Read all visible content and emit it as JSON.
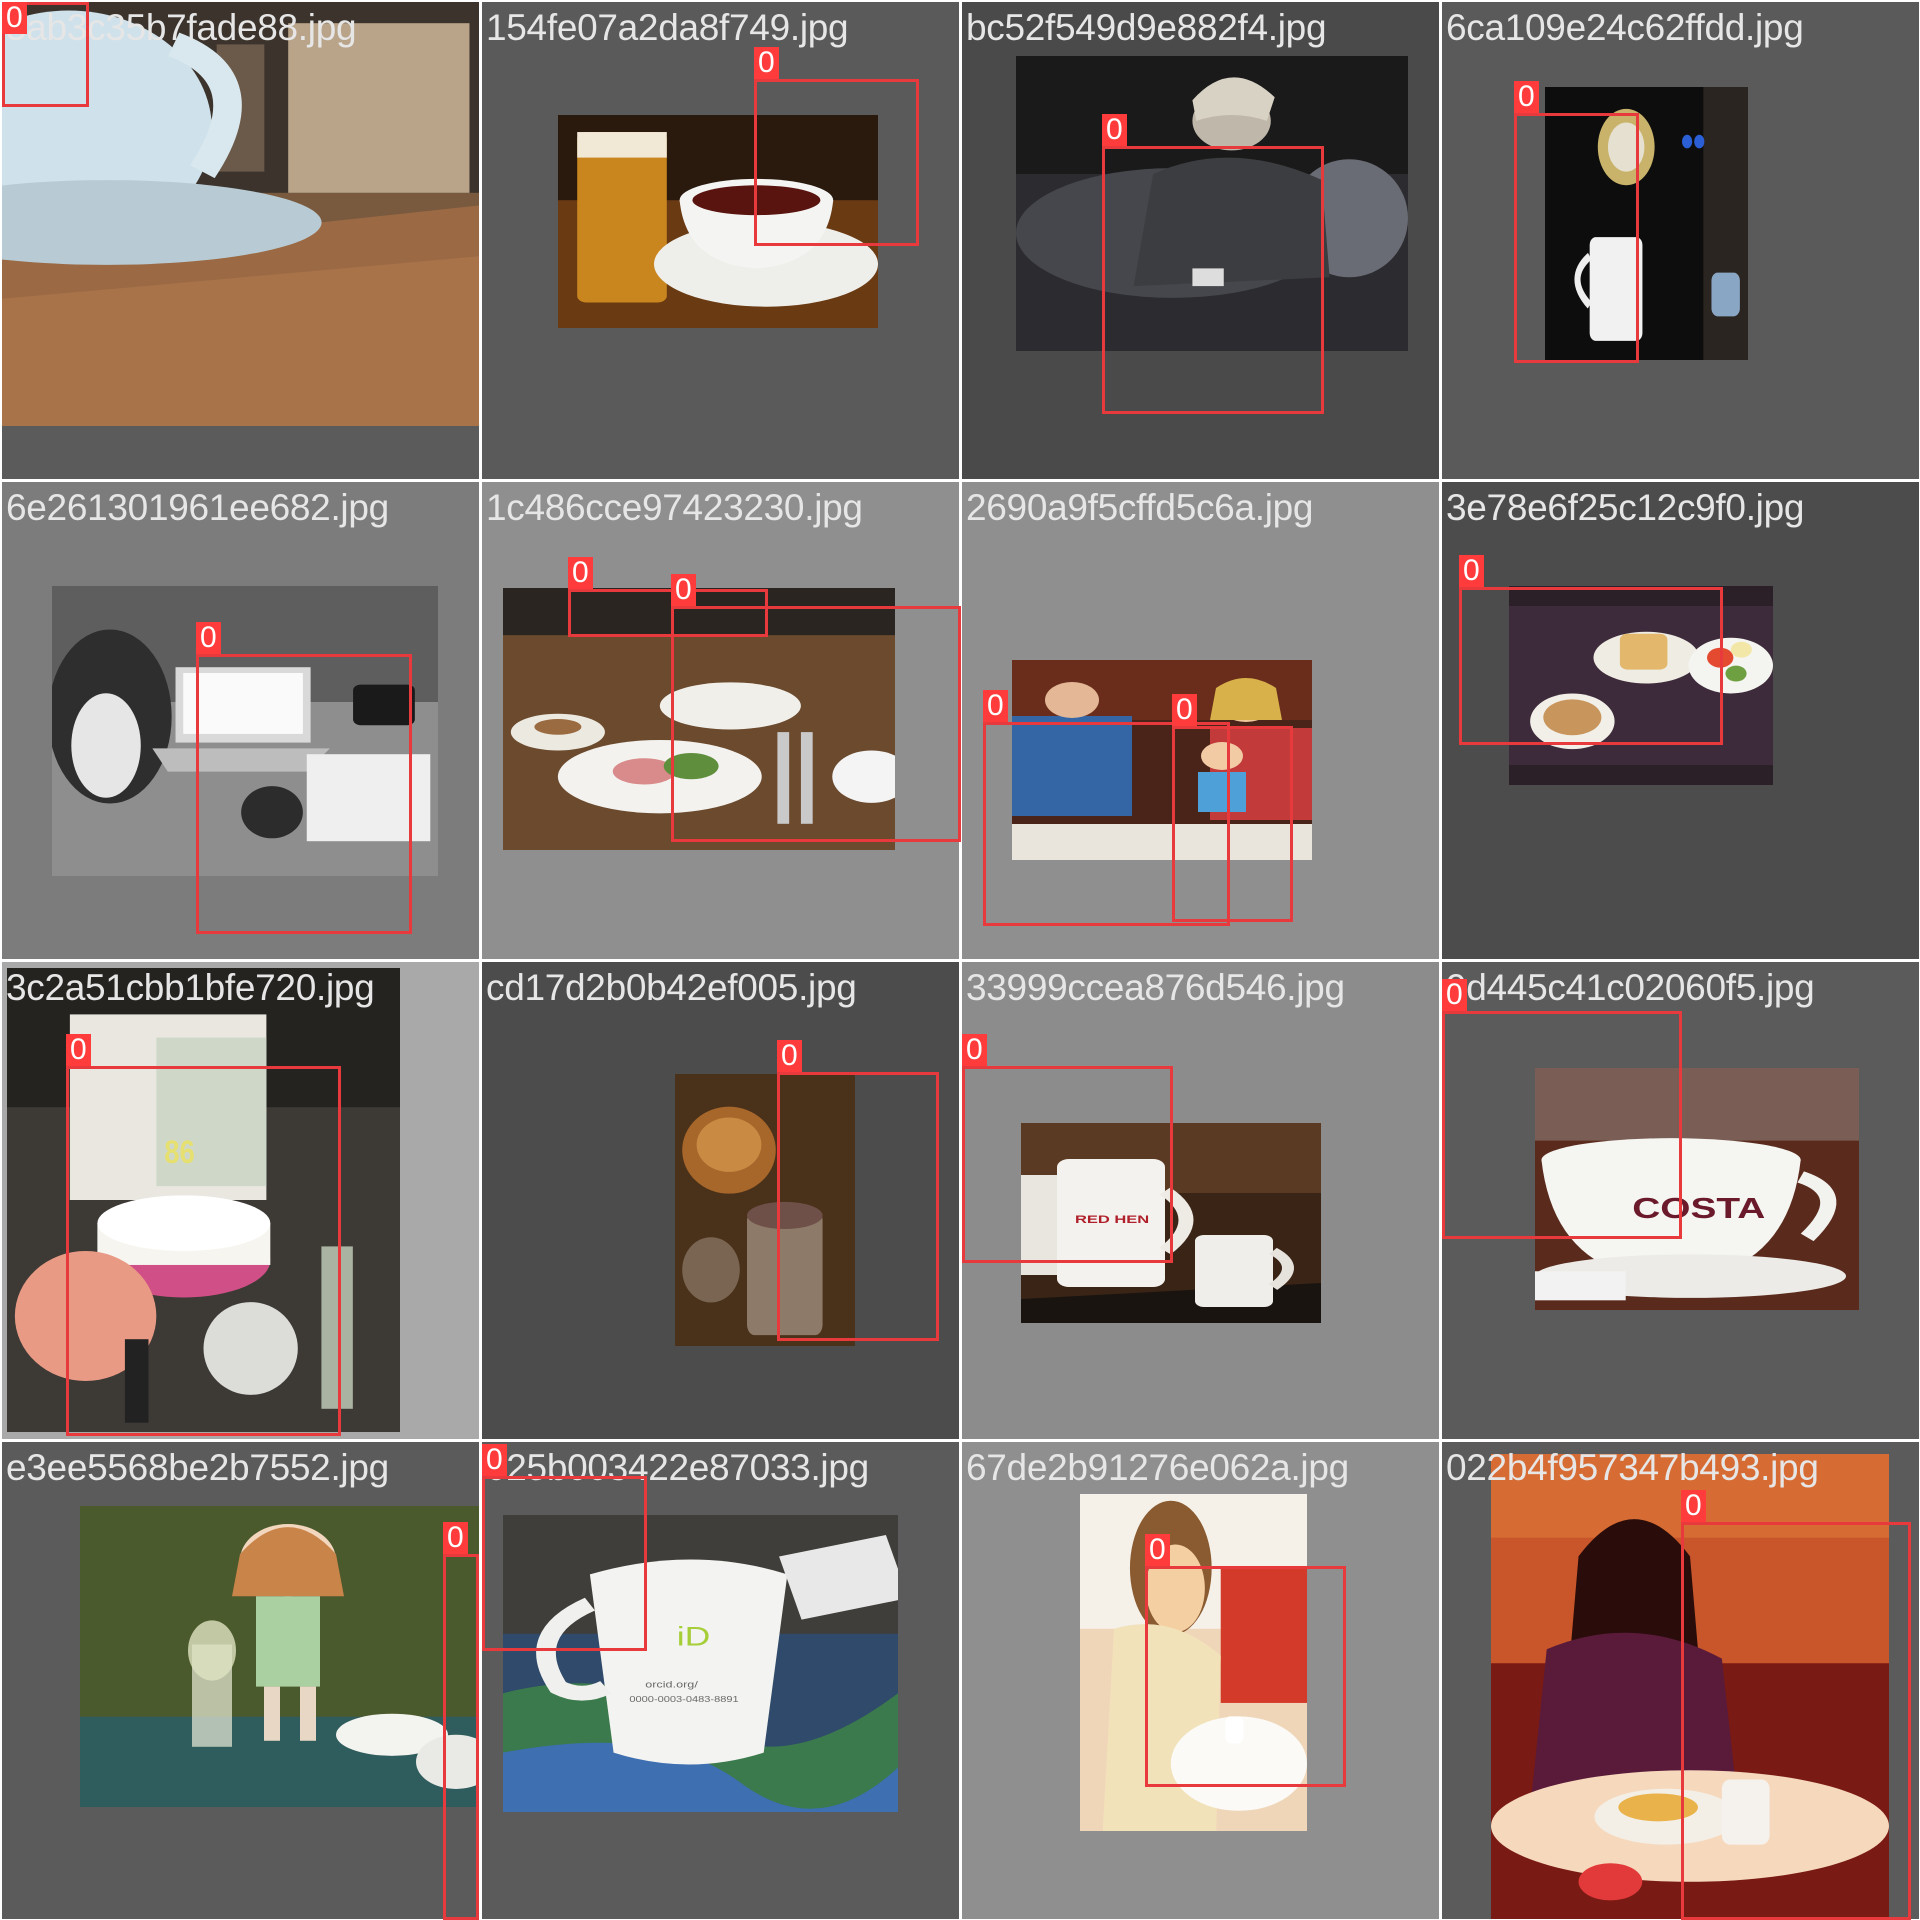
{
  "grid": {
    "tiles": [
      {
        "file": "5ab3c35b7fade88.jpg",
        "label": "0",
        "scene": "coffee cup in record shop",
        "bg": "#5b5b5b"
      },
      {
        "file": "154fe07a2da8f749.jpg",
        "label": "0",
        "scene": "beer and tea cup",
        "bg": "#5a5a5a"
      },
      {
        "file": "bc52f549d9e882f4.jpg",
        "label": "0",
        "scene": "person holding cup on bed",
        "bg": "#4a4a4a"
      },
      {
        "file": "6ca109e24c62ffdd.jpg",
        "label": "0",
        "scene": "coffee machine with mug",
        "bg": "#5a5a5a"
      },
      {
        "file": "6e261301961ee682.jpg",
        "label": "0",
        "scene": "cat, laptop and mug",
        "bg": "#7c7c7c"
      },
      {
        "file": "1c486cce97423230.jpg",
        "label": "0",
        "scene": "breakfast table",
        "bg": "#8f8f8f"
      },
      {
        "file": "2690a9f5cffd5c6a.jpg",
        "label": "0",
        "scene": "family at tea table",
        "bg": "#8f8f8f"
      },
      {
        "file": "3e78e6f25c12c9f0.jpg",
        "label": "0",
        "scene": "toast, coffee and salad tray",
        "bg": "#4c4c4c"
      },
      {
        "file": "3c2a51cbb1bfe720.jpg",
        "label": "0",
        "scene": "birthday cake table",
        "bg": "#a9a9a9"
      },
      {
        "file": "cd17d2b0b42ef005.jpg",
        "label": "0",
        "scene": "mug with bread",
        "bg": "#4c4c4c"
      },
      {
        "file": "33999ccea876d546.jpg",
        "label": "0",
        "scene": "Red Hen mugs",
        "bg": "#8c8c8c"
      },
      {
        "file": "9d445c41c02060f5.jpg",
        "label": "0",
        "scene": "Costa cup",
        "bg": "#5b5b5b"
      },
      {
        "file": "e3ee5568be2b7552.jpg",
        "label": "0",
        "scene": "doll picnic",
        "bg": "#5b5b5b"
      },
      {
        "file": "025b003422e87033.jpg",
        "label": "0",
        "scene": "orcid mug",
        "bg": "#5b5b5b"
      },
      {
        "file": "67de2b91276e062a.jpg",
        "label": "0",
        "scene": "woman at table",
        "bg": "#8f8f8f"
      },
      {
        "file": "022b4f957347b493.jpg",
        "label": "0",
        "scene": "woman at restaurant",
        "bg": "#5b5b5b"
      }
    ],
    "photo_texts": {
      "costa": "COSTA",
      "red_hen": "RED HEN",
      "cake_number": "86",
      "orcid_badge": "iD",
      "orcid_url": "orcid.org/",
      "orcid_num": "0000-0003-0483-8891"
    },
    "box_color": "#e8393c"
  }
}
